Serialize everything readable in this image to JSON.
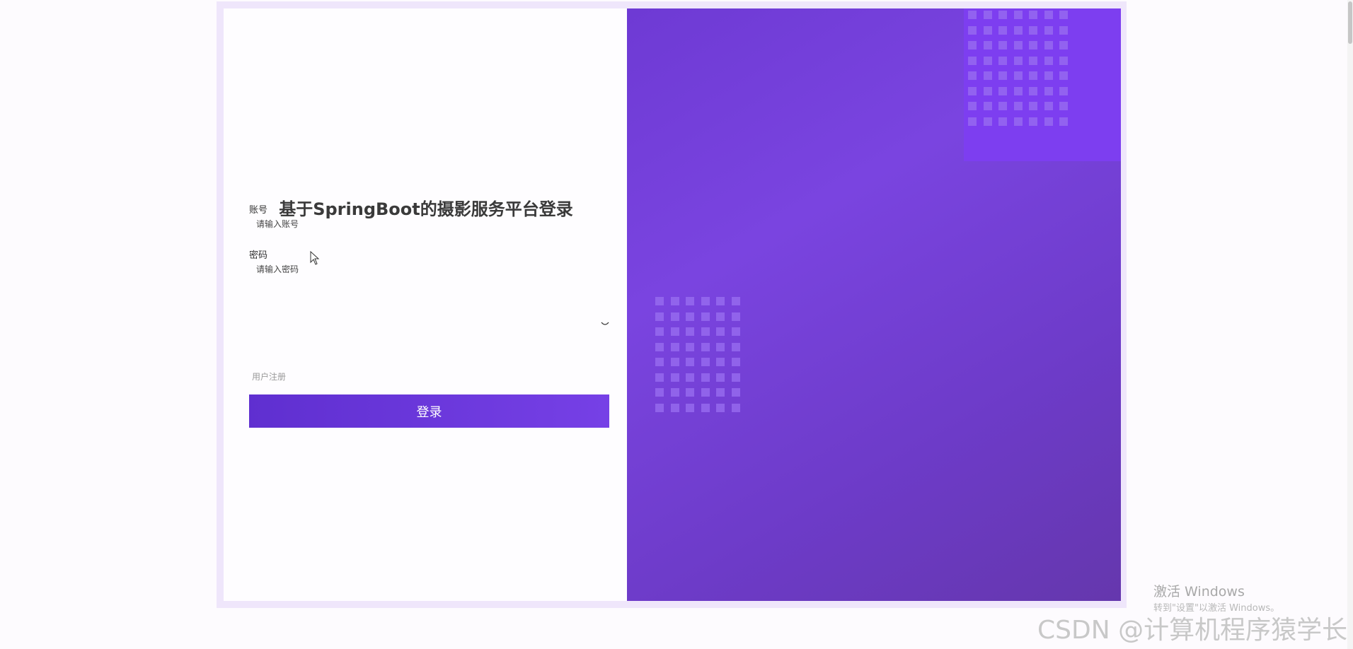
{
  "login": {
    "title": "基于SpringBoot的摄影服务平台登录",
    "account_label": "账号",
    "account_placeholder": "请输入账号",
    "password_label": "密码",
    "password_placeholder": "请输入密码",
    "register_link": "用户注册",
    "login_button": "登录"
  },
  "icons": {
    "password_toggle": "eye-closed-icon",
    "cursor": "mouse-pointer-icon"
  },
  "watermarks": {
    "windows_title": "激活 Windows",
    "windows_sub": "转到\"设置\"以激活 Windows。",
    "csdn": "CSDN @计算机程序猿学长"
  },
  "colors": {
    "accent": "#6e3ad4",
    "button_start": "#5f2fd0",
    "button_end": "#7640e6",
    "card_border": "#efe6fb"
  }
}
